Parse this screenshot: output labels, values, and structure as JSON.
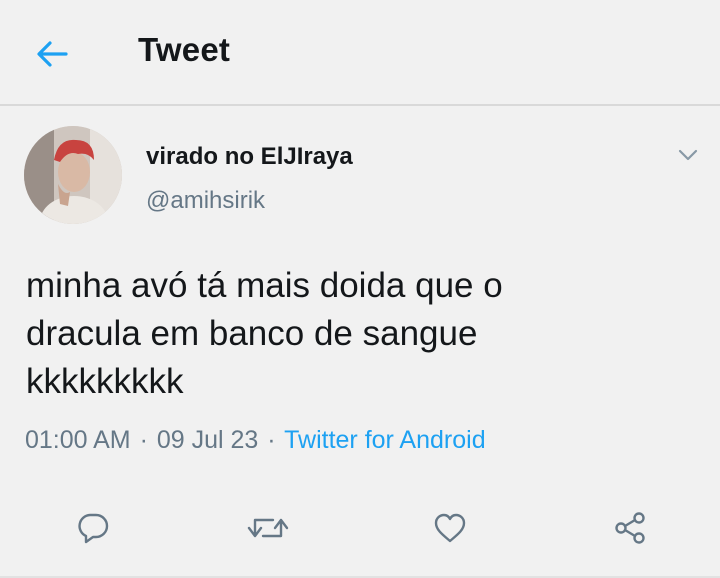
{
  "header": {
    "title": "Tweet",
    "back_icon": "arrow-left-icon"
  },
  "tweet": {
    "author_name": "virado no ElJIraya",
    "author_handle": "@amihsirik",
    "text_lines": [
      "minha avó tá mais doida que o",
      "dracula em banco de sangue",
      "kkkkkkkkk"
    ],
    "time": "01:00 AM",
    "date": "09 Jul 23",
    "source": "Twitter for Android",
    "separator": "·"
  },
  "actions": [
    "reply-icon",
    "retweet-icon",
    "like-icon",
    "share-icon"
  ],
  "colors": {
    "accent": "#1da1f2",
    "muted": "#657786",
    "text": "#14171a",
    "background": "#f1f1f1"
  }
}
